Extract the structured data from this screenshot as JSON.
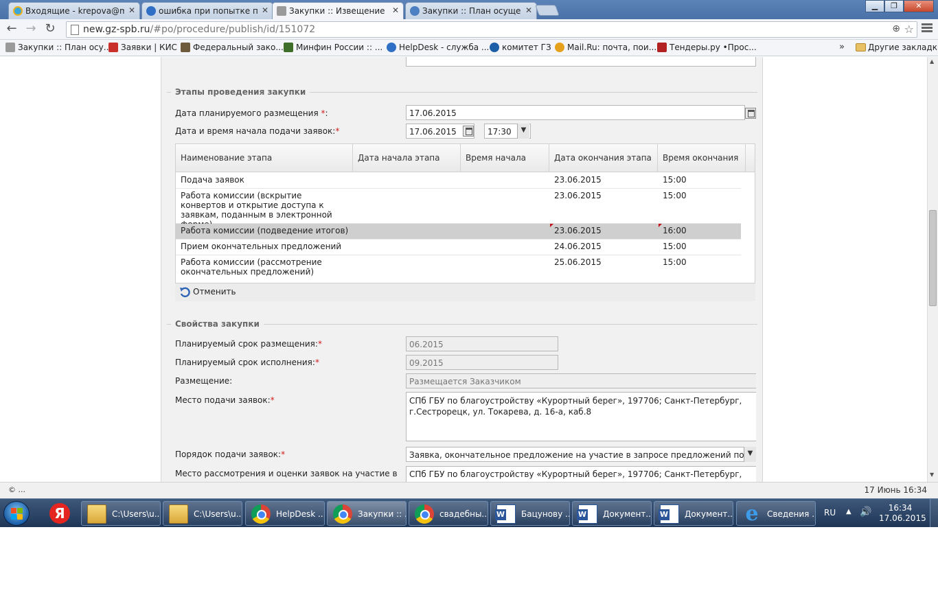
{
  "browser": {
    "tabs": [
      {
        "title": "Входящие - krepova@ma",
        "favicon_color": "#3aa7d8"
      },
      {
        "title": "ошибка при попытке пут",
        "favicon_color": "#2f6fc6"
      },
      {
        "title": "Закупки :: Извещение о г",
        "favicon_color": "#8a8a8a"
      },
      {
        "title": "Закупки :: План осущест",
        "favicon_color": "#4d7fc3"
      }
    ],
    "close_glyph": "✕",
    "window_buttons": {
      "minimize": "▁",
      "maximize": "❐",
      "close": "✕"
    },
    "nav": {
      "back": "←",
      "forward": "→",
      "reload": "↻"
    },
    "url_host": "new.gz-spb.ru",
    "url_path": "/#po/procedure/publish/id/151072",
    "zoom_glyph": "⊕",
    "star_glyph": "☆",
    "bookmarks": [
      {
        "label": "Закупки :: План осу...",
        "color": "#9a9a9a"
      },
      {
        "label": "Заявки | КИС",
        "color": "#c9302c"
      },
      {
        "label": "Федеральный зако...",
        "color": "#6d5b3c"
      },
      {
        "label": "Минфин России :: ...",
        "color": "#3f6e2a"
      },
      {
        "label": "HelpDesk - служба ...",
        "color": "#2f6fc6"
      },
      {
        "label": "комитет ГЗ",
        "color": "#1d5fa8"
      },
      {
        "label": "Mail.Ru: почта, пои...",
        "color": "#e5a11c"
      },
      {
        "label": "Тендеры.ру •Прос...",
        "color": "#b22222"
      }
    ],
    "bookmarks_more": "»",
    "other_bookmarks": "Другие закладки"
  },
  "stages": {
    "legend": "Этапы проведения закупки",
    "planned_date_label": "Дата планируемого размещения",
    "planned_date_value": "17.06.2015",
    "start_label": "Дата и время начала подачи заявок:",
    "start_date_value": "17.06.2015",
    "start_time_value": "17:30",
    "required_mark": "*",
    "colon": ":",
    "columns": [
      "Наименование этапа",
      "Дата начала этапа",
      "Время начала",
      "Дата окончания этапа",
      "Время окончания"
    ],
    "rows": [
      {
        "name": "Подача заявок",
        "start_date": "",
        "start_time": "",
        "end_date": "23.06.2015",
        "end_time": "15:00"
      },
      {
        "name": "Работа комиссии (вскрытие конвертов и открытие доступа к заявкам, поданным в электронной форме)",
        "start_date": "",
        "start_time": "",
        "end_date": "23.06.2015",
        "end_time": "15:00"
      },
      {
        "name": "Работа комиссии (подведение итогов)",
        "start_date": "",
        "start_time": "",
        "end_date": "23.06.2015",
        "end_time": "16:00"
      },
      {
        "name": "Прием окончательных предложений",
        "start_date": "",
        "start_time": "",
        "end_date": "24.06.2015",
        "end_time": "15:00"
      },
      {
        "name": "Работа комиссии (рассмотрение окончательных предложений)",
        "start_date": "",
        "start_time": "",
        "end_date": "25.06.2015",
        "end_time": "15:00"
      }
    ],
    "selected_row": 2,
    "cancel_label": "Отменить"
  },
  "properties": {
    "legend": "Свойства закупки",
    "placement_term_label": "Планируемый срок размещения:",
    "placement_term_value": "06.2015",
    "execution_term_label": "Планируемый срок исполнения:",
    "execution_term_value": "09.2015",
    "placement_label": "Размещение:",
    "placement_value": "Размещается Заказчиком",
    "submission_place_label": "Место подачи заявок:",
    "submission_place_value": "СПб ГБУ по благоустройству «Курортный берег», 197706; Санкт-Петербург, г.Сестрорецк, ул. Токарева, д. 16-а, каб.8",
    "submission_order_label": "Порядок подачи заявок:",
    "submission_order_value": "Заявка, окончательное предложение на участие в запросе предложений подает",
    "review_place_label": "Место рассмотрения и оценки заявок на участие в",
    "review_place_value": "СПб ГБУ по благоустройству «Курортный берег», 197706; Санкт-Петербург,"
  },
  "statusbar": {
    "left": "© ...",
    "right": "17 Июнь 16:34"
  },
  "taskbar": {
    "items": [
      {
        "label": "C:\\Users\\u...",
        "icon": "folder-icon"
      },
      {
        "label": "C:\\Users\\u...",
        "icon": "folder-icon"
      },
      {
        "label": "HelpDesk ...",
        "icon": "chrome-icon"
      },
      {
        "label": "Закупки :: ...",
        "icon": "chrome-icon"
      },
      {
        "label": "свадебны...",
        "icon": "chrome-icon"
      },
      {
        "label": "Бацунову ...",
        "icon": "word-icon"
      },
      {
        "label": "Документ...",
        "icon": "word-icon"
      },
      {
        "label": "Документ...",
        "icon": "word-icon"
      },
      {
        "label": "Сведения ...",
        "icon": "ie-icon"
      }
    ],
    "active_index": 3,
    "yandex_glyph": "Я",
    "ie_glyph": "e",
    "tray_lang": "RU",
    "tray_arrow": "▲",
    "tray_volume": "🔊",
    "clock_time": "16:34",
    "clock_date": "17.06.2015"
  }
}
